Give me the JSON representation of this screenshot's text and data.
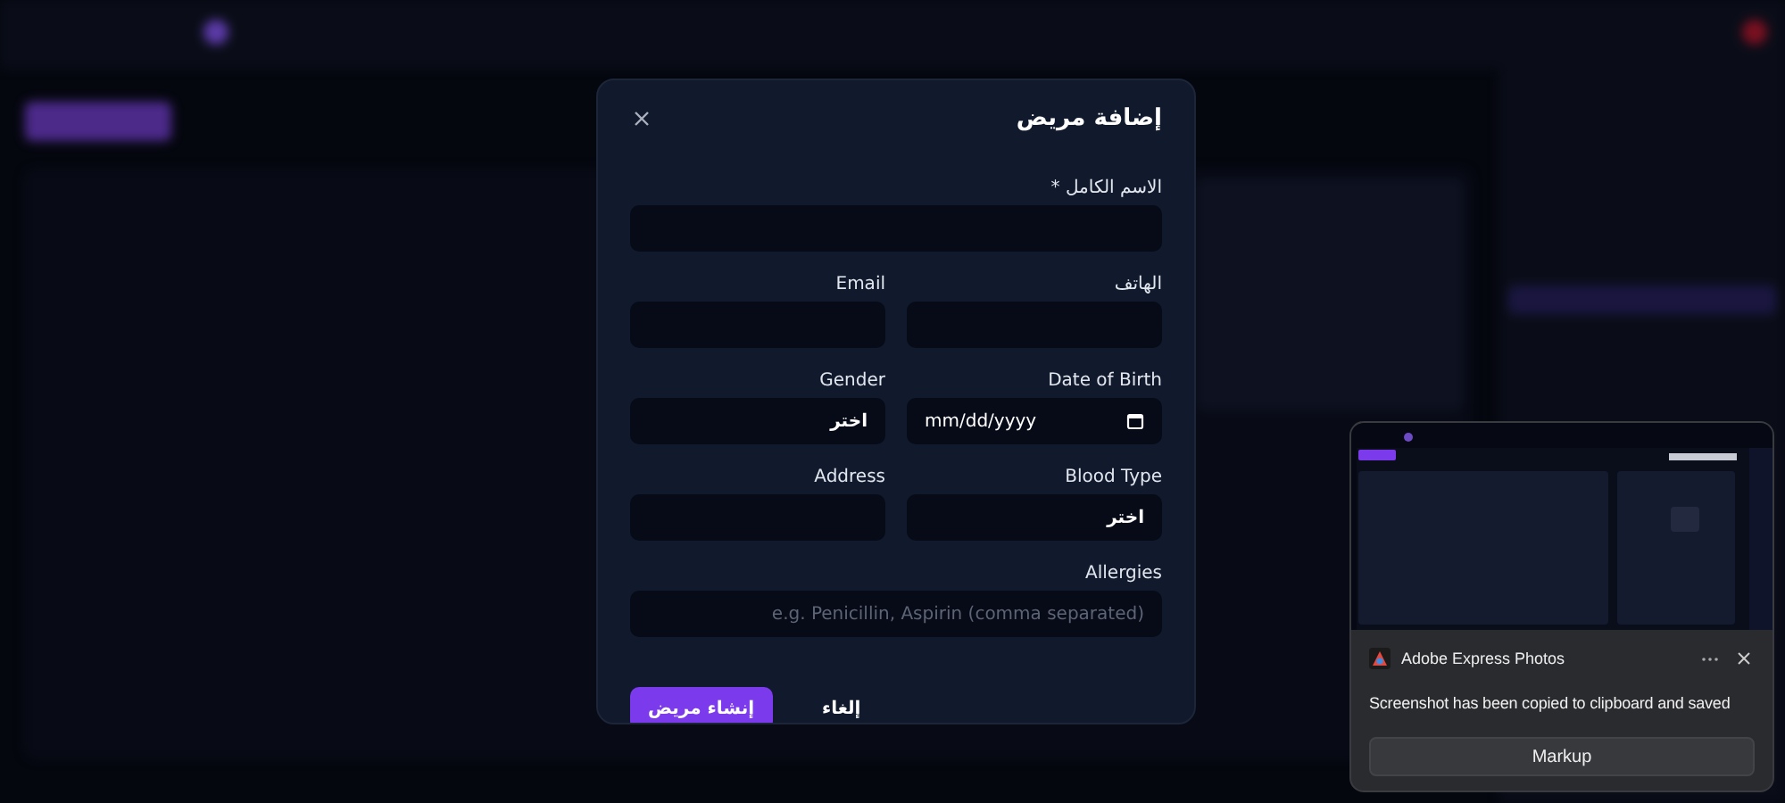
{
  "dialog": {
    "title": "إضافة مريض",
    "fields": [
      {
        "kind": "text",
        "label": "الاسم الكامل *",
        "wide": true
      },
      {
        "kind": "text",
        "label": "الهاتف",
        "wide": false
      },
      {
        "kind": "text",
        "label": "Email",
        "wide": false
      },
      {
        "kind": "date",
        "label": "Date of Birth",
        "value": "mm/dd/yyyy",
        "wide": false
      },
      {
        "kind": "select",
        "label": "Gender",
        "value": "اختر",
        "wide": false
      },
      {
        "kind": "select",
        "label": "Blood Type",
        "value": "اختر",
        "wide": false
      },
      {
        "kind": "text",
        "label": "Address",
        "wide": false
      },
      {
        "kind": "text",
        "label": "Allergies",
        "placeholder": "e.g. Penicillin, Aspirin (comma separated)",
        "wide": true
      }
    ],
    "buttons": [
      {
        "kind": "secondary",
        "label": "إلغاء"
      },
      {
        "kind": "primary",
        "label": "إنشاء مريض"
      }
    ]
  },
  "notification": {
    "app": "Adobe Express Photos",
    "message": "Screenshot has been copied to clipboard and saved",
    "action": "Markup"
  }
}
